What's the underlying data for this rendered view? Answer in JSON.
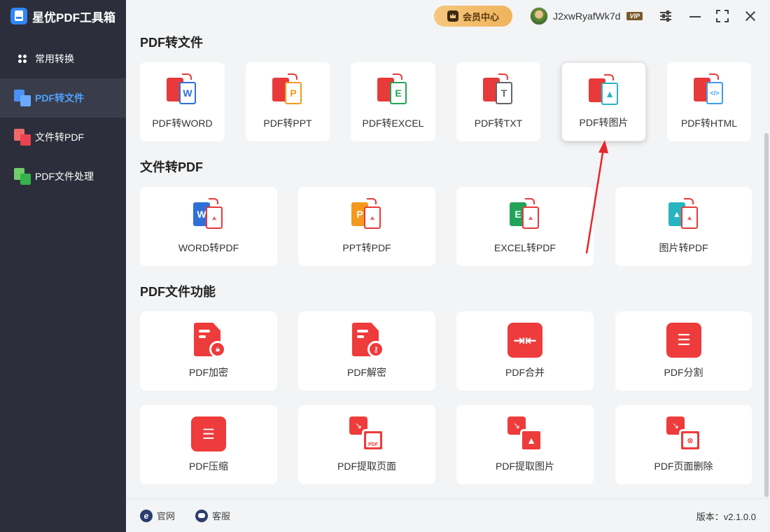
{
  "app": {
    "title": "星优PDF工具箱"
  },
  "sidebar": {
    "items": [
      {
        "label": "常用转换"
      },
      {
        "label": "PDF转文件"
      },
      {
        "label": "文件转PDF"
      },
      {
        "label": "PDF文件处理"
      }
    ]
  },
  "header": {
    "vip_center": "会员中心",
    "username": "J2xwRyafWk7d",
    "vip_badge": "VIP"
  },
  "sections": {
    "pdf_to_file": {
      "title": "PDF转文件",
      "items": [
        "PDF转WORD",
        "PDF转PPT",
        "PDF转EXCEL",
        "PDF转TXT",
        "PDF转图片",
        "PDF转HTML"
      ],
      "selected": "PDF转图片"
    },
    "file_to_pdf": {
      "title": "文件转PDF",
      "items": [
        "WORD转PDF",
        "PPT转PDF",
        "EXCEL转PDF",
        "图片转PDF"
      ]
    },
    "pdf_functions": {
      "title": "PDF文件功能",
      "items": [
        "PDF加密",
        "PDF解密",
        "PDF合并",
        "PDF分割",
        "PDF压缩",
        "PDF提取页面",
        "PDF提取图片",
        "PDF页面删除"
      ]
    }
  },
  "footer": {
    "website": "官网",
    "support": "客服",
    "version": "版本：v2.1.0.0"
  },
  "icons": {
    "word_letter": "W",
    "ppt_letter": "P",
    "excel_letter": "E",
    "txt_letter": "T",
    "html_letter": "</>",
    "compress_glyph": "☰",
    "pdf_small": "PDF"
  },
  "colors": {
    "sidebar_bg": "#2c2f3b",
    "active_nav": "#4fa0ff",
    "accent_red": "#ee3b3b",
    "word_blue": "#2f6fd8",
    "ppt_orange": "#f39a1e",
    "excel_green": "#22a35a",
    "txt_gray": "#666666",
    "image_teal": "#27b5c2",
    "html_blue": "#3a9cf0"
  }
}
